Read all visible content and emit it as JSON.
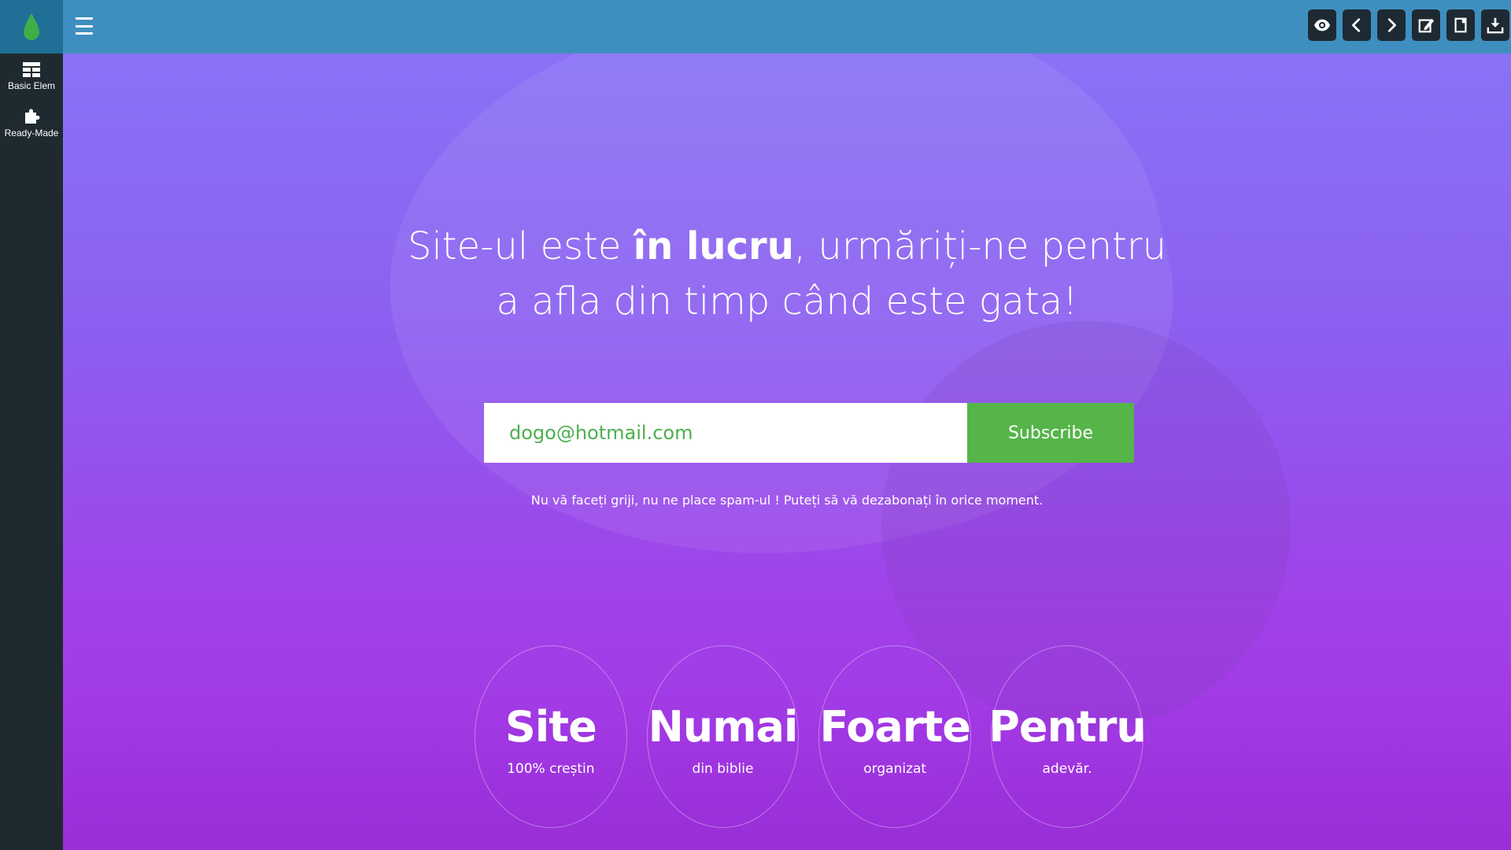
{
  "sidebar": {
    "items": [
      {
        "label": "Basic Elem",
        "icon": "grid-icon"
      },
      {
        "label": "Ready-Made",
        "icon": "puzzle-icon"
      }
    ]
  },
  "toolbar": {
    "icons": [
      "eye-icon",
      "chevron-left-icon",
      "chevron-right-icon",
      "edit-icon",
      "page-icon",
      "download-icon"
    ]
  },
  "hero": {
    "headline_part1": "Site-ul este ",
    "headline_bold": "în lucru",
    "headline_part2": ", urmăriți-ne pentru",
    "headline_line2": "a afla din timp când este gata!",
    "email_value": "dogo@hotmail.com",
    "subscribe_label": "Subscribe",
    "note": "Nu vă faceți griji, nu ne place spam-ul ! Puteți să vă dezabonați în orice moment."
  },
  "features": [
    {
      "title": "Site",
      "subtitle": "100% creștin"
    },
    {
      "title": "Numai",
      "subtitle": "din biblie"
    },
    {
      "title": "Foarte",
      "subtitle": "organizat"
    },
    {
      "title": "Pentru",
      "subtitle": "adevăr."
    }
  ],
  "colors": {
    "topbar": "#3e8fc0",
    "sidebar": "#1f2a30",
    "accent_green": "#55b549",
    "email_text": "#4caf50"
  }
}
